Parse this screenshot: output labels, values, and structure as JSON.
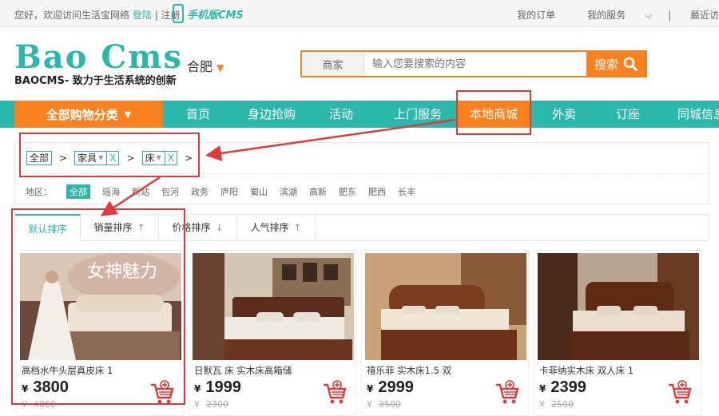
{
  "topbar": {
    "welcome": "您好，欢迎访问生活宝网络",
    "login": "登陆",
    "register": "注册",
    "mobile_label": "手机版CMS",
    "my_orders": "我的订单",
    "my_services": "我的服务",
    "recent": "最近访"
  },
  "header": {
    "logo_text": "Bao Cms",
    "logo_sub": "BAOCMS- 致力于生活系统的创新",
    "city": "合肥",
    "search_type": "商家",
    "search_placeholder": "输入您要搜索的内容",
    "search_button": "搜索"
  },
  "nav": {
    "all_categories": "全部购物分类",
    "items": [
      "首页",
      "身边抢购",
      "活动",
      "上门服务",
      "本地商城",
      "外卖",
      "订座",
      "同城信息"
    ],
    "active_index": 4
  },
  "filter": {
    "crumbs": [
      "全部",
      "家具",
      "床"
    ],
    "area_label": "地区：",
    "areas": [
      "全部",
      "瑶海",
      "新站",
      "包河",
      "政务",
      "庐阳",
      "蜀山",
      "滨湖",
      "高新",
      "肥东",
      "肥西",
      "长丰"
    ],
    "selected_area_index": 0
  },
  "sort": {
    "tabs": [
      {
        "label": "默认排序",
        "arrow": ""
      },
      {
        "label": "销量排序",
        "arrow": "↑"
      },
      {
        "label": "价格排序",
        "arrow": "↓"
      },
      {
        "label": "人气排序",
        "arrow": "↑"
      }
    ]
  },
  "products": [
    {
      "title": "高档水牛头层真皮床 1",
      "currency": "¥",
      "price": "3800",
      "old_price": "4800",
      "banner_text": "女神魅力"
    },
    {
      "title": "日默瓦 床 实木床高箱储",
      "currency": "¥",
      "price": "1999",
      "old_price": "2300"
    },
    {
      "title": "禧乐菲 实木床1.5 双",
      "currency": "¥",
      "price": "2999",
      "old_price": "3500"
    },
    {
      "title": "卡菲纳实木床 双人床 1",
      "currency": "¥",
      "price": "2399",
      "old_price": "2500"
    }
  ],
  "colors": {
    "brand": "#2bb8aa",
    "accent": "#f7811e",
    "highlight": "#e03a3a"
  }
}
